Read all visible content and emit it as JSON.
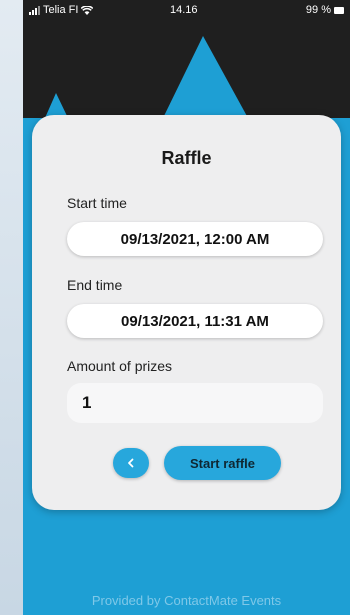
{
  "status_bar": {
    "carrier": "Telia FI",
    "time": "14.16",
    "battery": "99 %"
  },
  "raffle": {
    "title": "Raffle",
    "start_label": "Start time",
    "start_value": "09/13/2021, 12:00 AM",
    "end_label": "End time",
    "end_value": "09/13/2021, 11:31 AM",
    "amount_label": "Amount of prizes",
    "amount_value": "1",
    "back_icon": "chevron-left-icon",
    "start_button": "Start raffle"
  },
  "footer": {
    "text": "Provided by ContactMate Events"
  },
  "colors": {
    "accent": "#27a7dc",
    "background_blue": "#1e9fd4",
    "hero_dark": "#1e1e1e",
    "card": "#eeeeef"
  }
}
